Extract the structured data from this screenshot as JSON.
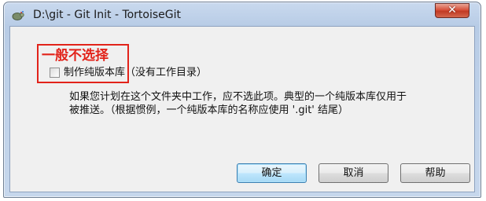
{
  "window": {
    "title": "D:\\git - Git Init - TortoiseGit",
    "close_glyph": "✕",
    "icon": "tortoisegit-icon"
  },
  "annotation": {
    "text": "一般不选择",
    "color": "#e2231a"
  },
  "options": {
    "bare_repo": {
      "label": "制作纯版本库（没有工作目录）",
      "checked": false
    }
  },
  "description": "如果您计划在这个文件夹中工作，应不选此项。典型的一个纯版本库仅用于\n被推送。（根据惯例，一个纯版本库的名称应使用 '.git' 结尾）",
  "buttons": {
    "ok": "确定",
    "cancel": "取消",
    "help": "帮助"
  }
}
